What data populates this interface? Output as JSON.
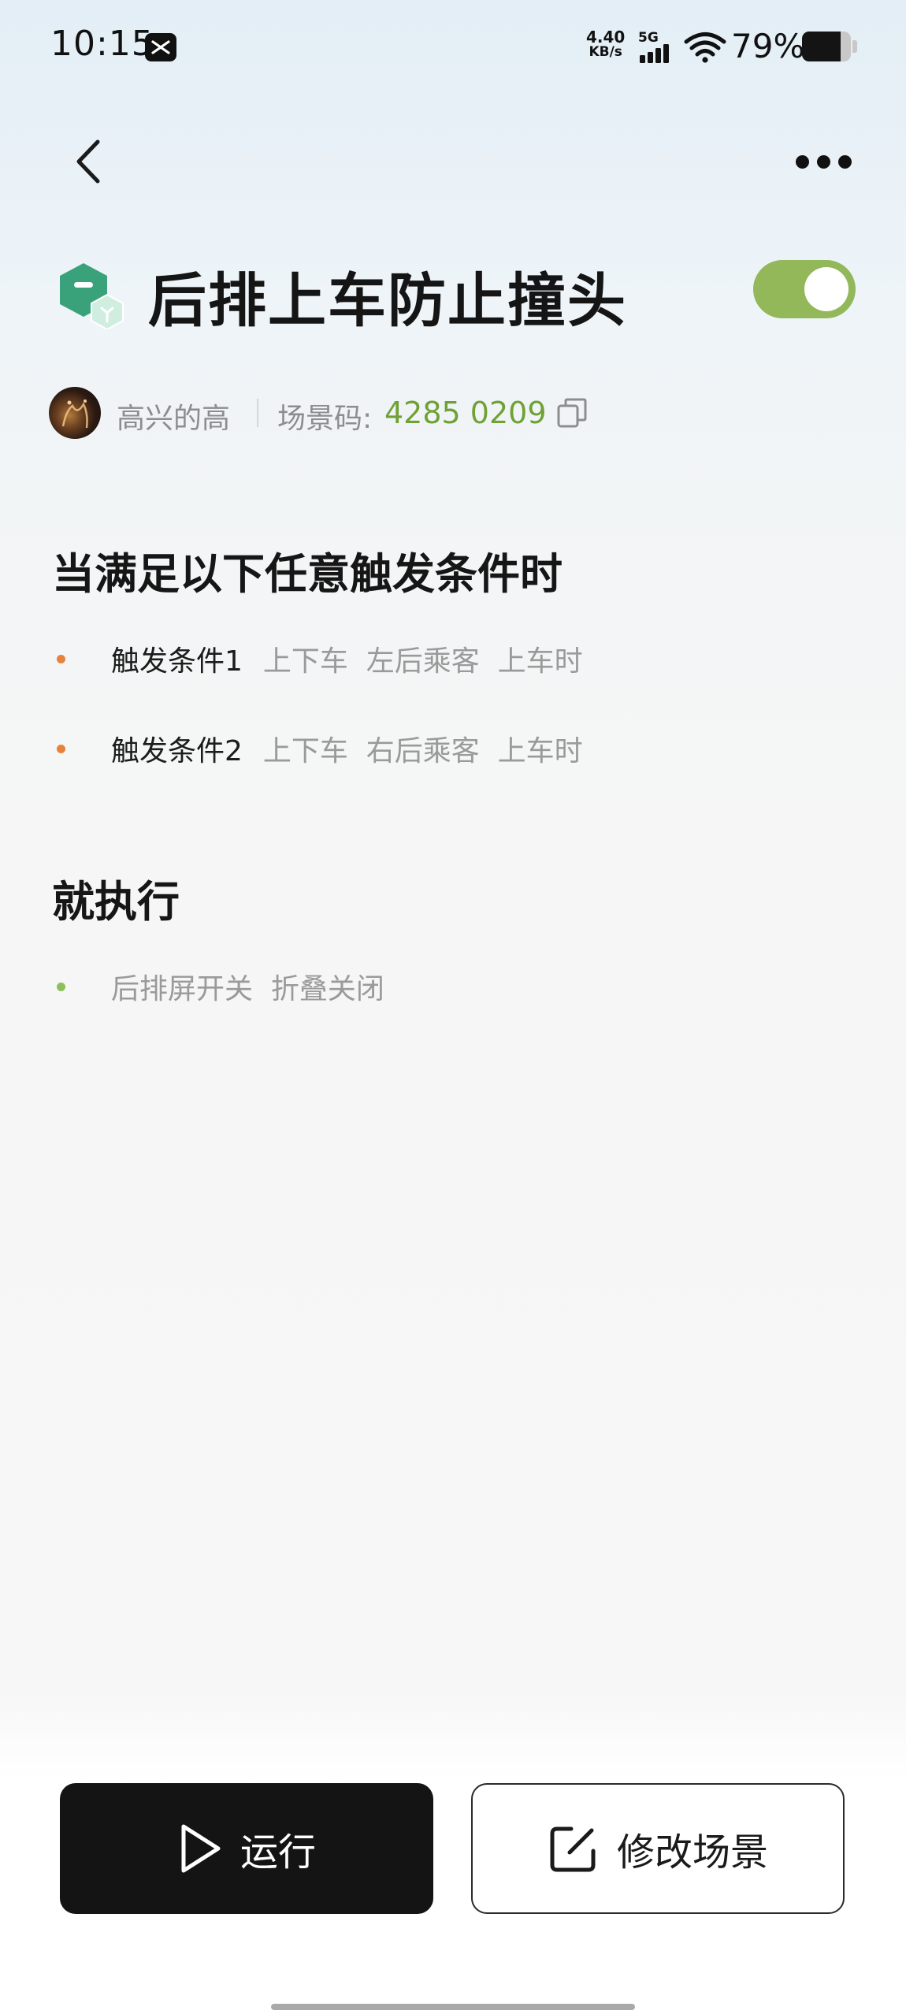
{
  "status_bar": {
    "time": "10:15",
    "net_speed_value": "4.40",
    "net_speed_unit": "KB/s",
    "network_gen": "5G",
    "battery_percent_text": "79%",
    "battery_level": 0.79,
    "icons": [
      "capcut-app-icon",
      "signal-icon",
      "wifi-icon",
      "battery-icon"
    ]
  },
  "nav": {
    "back_icon": "chevron-left-icon",
    "more_icon": "more-dots-icon"
  },
  "scene": {
    "title": "后排上车防止撞头",
    "enabled": true,
    "icon": "scene-cube-icon",
    "author": "高兴的高",
    "code_label": "场景码:",
    "code_value": "4285 0209"
  },
  "trigger_section": {
    "heading": "当满足以下任意触发条件时",
    "items": [
      {
        "name": "触发条件1",
        "detail": "上下车  左后乘客  上车时"
      },
      {
        "name": "触发条件2",
        "detail": "上下车  右后乘客  上车时"
      }
    ]
  },
  "action_section": {
    "heading": "就执行",
    "items": [
      {
        "detail": "后排屏开关  折叠关闭"
      }
    ]
  },
  "buttons": {
    "run_label": "运行",
    "edit_label": "修改场景"
  },
  "colors": {
    "accent_green": "#92b85a",
    "code_green": "#6fa135",
    "trigger_dot": "#e8823a",
    "action_dot": "#8bbf5a"
  }
}
